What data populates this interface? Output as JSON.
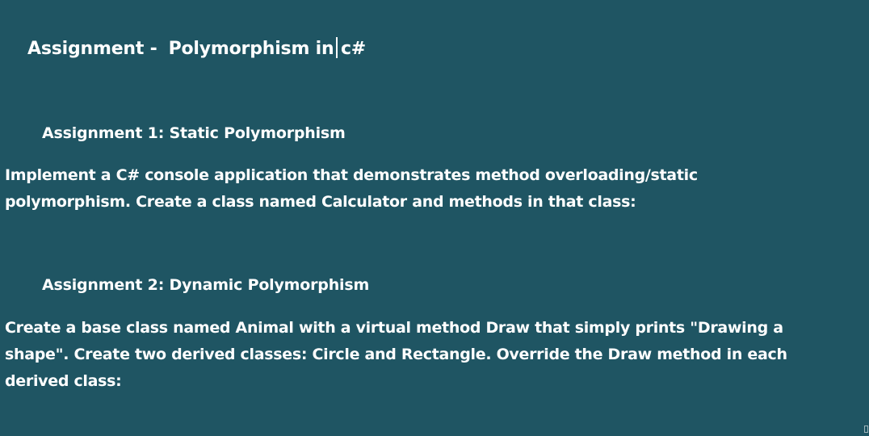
{
  "slide": {
    "title": {
      "prefix": "Assignment -",
      "topic_before_caret": "Polymorphism in",
      "topic_after_caret": "c#"
    },
    "assignment1": {
      "heading": "Assignment 1: Static Polymorphism",
      "lines": [
        "Implement a C# console application that demonstrates method overloading/static",
        "polymorphism. Create a class named Calculator and methods in that class:"
      ]
    },
    "assignment2": {
      "heading": "Assignment 2:  Dynamic Polymorphism",
      "lines": [
        "Create a base class named Animal with a virtual method Draw that simply prints \"Drawing a",
        "shape\". Create two derived classes: Circle and Rectangle. Override the Draw method in each",
        "derived class:"
      ]
    }
  },
  "colors": {
    "background": "#1f5563",
    "text": "#ffffff"
  },
  "icons": {
    "text_caret": "text-cursor",
    "corner": "resize-handle"
  }
}
